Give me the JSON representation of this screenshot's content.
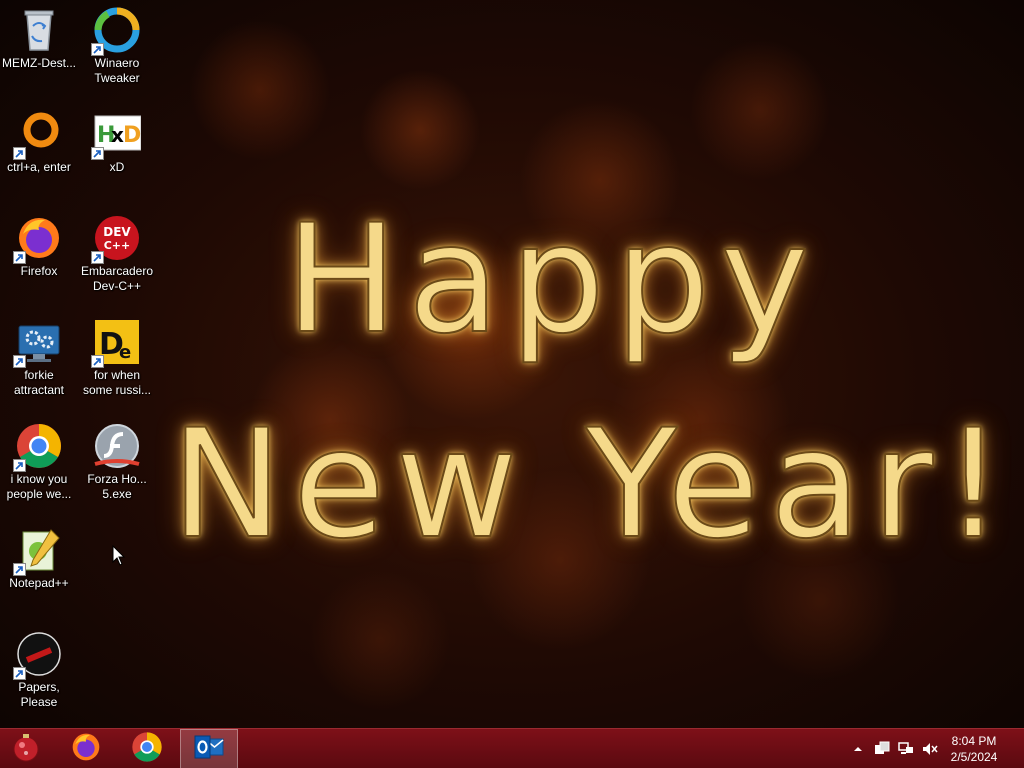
{
  "wallpaper": {
    "line1": "Happy",
    "line2": "New Year!"
  },
  "desktop_icons": [
    {
      "label": "MEMZ-Dest...",
      "icon": "recycle-bin-icon"
    },
    {
      "label": "Winaero\nTweaker",
      "icon": "winaero-tweaker-icon"
    },
    {
      "label": "ctrl+a, enter",
      "icon": "orange-ring-icon"
    },
    {
      "label": "xD",
      "icon": "hxd-icon"
    },
    {
      "label": "Firefox",
      "icon": "firefox-icon"
    },
    {
      "label": "Embarcadero\nDev-C++",
      "icon": "devcpp-icon"
    },
    {
      "label": "forkie\nattractant",
      "icon": "computer-settings-icon"
    },
    {
      "label": "for when\nsome russi...",
      "icon": "die-icon"
    },
    {
      "label": "i know you\npeople we...",
      "icon": "chrome-icon"
    },
    {
      "label": "Forza Ho...\n5.exe",
      "icon": "flash-icon"
    },
    {
      "label": "Notepad++",
      "icon": "notepadpp-icon"
    },
    {
      "label": "Papers, Please",
      "icon": "papers-please-icon"
    }
  ],
  "taskbar": {
    "start_icon": "start-orb-icon",
    "pinned": [
      {
        "name": "Firefox",
        "icon": "firefox-icon"
      },
      {
        "name": "Google Chrome",
        "icon": "chrome-icon"
      },
      {
        "name": "Outlook",
        "icon": "outlook-icon",
        "active": true
      }
    ],
    "tray": [
      "show-hidden-icons-chevron",
      "action-center-flag-icon",
      "network-icon",
      "volume-muted-icon"
    ],
    "clock": {
      "time": "8:04 PM",
      "date": "2/5/2024"
    }
  },
  "colors": {
    "taskbar": "#7e1018",
    "light_text": "#f5d98a"
  }
}
